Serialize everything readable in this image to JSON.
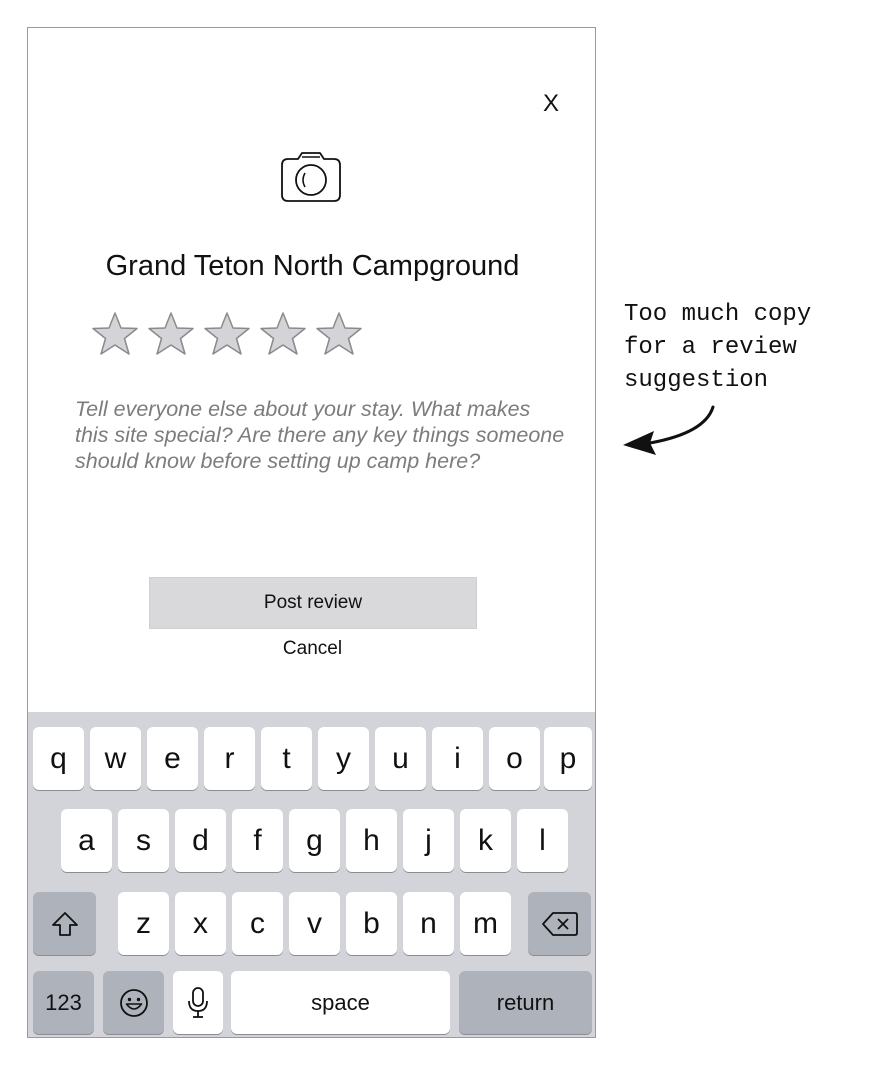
{
  "dialog": {
    "close_label": "X",
    "title": "Grand Teton North Campground",
    "rating": {
      "filled": 0,
      "max": 5
    },
    "review_placeholder": "Tell everyone else about your stay. What makes this site special? Are there any key things someone should know before setting up camp here?",
    "post_label": "Post review",
    "cancel_label": "Cancel"
  },
  "keyboard": {
    "row1": [
      "q",
      "w",
      "e",
      "r",
      "t",
      "y",
      "u",
      "i",
      "o",
      "p"
    ],
    "row2": [
      "a",
      "s",
      "d",
      "f",
      "g",
      "h",
      "j",
      "k",
      "l"
    ],
    "row3": [
      "z",
      "x",
      "c",
      "v",
      "b",
      "n",
      "m"
    ],
    "numbers_label": "123",
    "space_label": "space",
    "return_label": "return"
  },
  "annotation": {
    "text": "Too much copy\nfor a review\nsuggestion"
  },
  "colors": {
    "star_fill": "#d4d4d8",
    "star_stroke": "#8a8a8a",
    "prompt_text": "#7c7c7c",
    "keyboard_bg": "#d2d4d9",
    "key_dark": "#aeb2bb"
  }
}
